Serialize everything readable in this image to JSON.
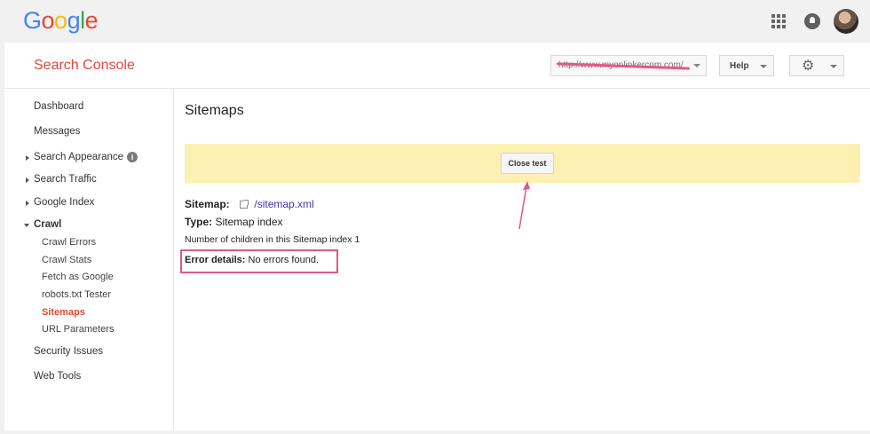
{
  "google_bar": {
    "logo": [
      "G",
      "o",
      "o",
      "g",
      "l",
      "e"
    ],
    "logo_colors": [
      "#4285f4",
      "#ea4335",
      "#fbbc05",
      "#4285f4",
      "#34a853",
      "#ea4335"
    ],
    "apps_icon": "apps-grid-icon",
    "notifications_icon": "bell-icon",
    "account_icon": "avatar"
  },
  "header": {
    "title": "Search Console",
    "site_url": "http://www.myonlinkercom.com/",
    "help_label": "Help",
    "settings_icon": "gear-icon"
  },
  "sidebar": {
    "dashboard": "Dashboard",
    "messages": "Messages",
    "search_appearance": "Search Appearance",
    "search_traffic": "Search Traffic",
    "google_index": "Google Index",
    "crawl": "Crawl",
    "crawl_errors": "Crawl Errors",
    "crawl_stats": "Crawl Stats",
    "fetch_as_google": "Fetch as Google",
    "robots_tester": "robots.txt Tester",
    "sitemaps": "Sitemaps",
    "url_parameters": "URL Parameters",
    "security_issues": "Security Issues",
    "web_tools": "Web Tools"
  },
  "main": {
    "page_title": "Sitemaps",
    "close_test_label": "Close test",
    "sitemap_label": "Sitemap:",
    "sitemap_url": "/sitemap.xml",
    "type_label": "Type:",
    "type_value": "Sitemap index",
    "children_text": "Number of children in this Sitemap index 1",
    "error_label": "Error details:",
    "error_value": "No errors found."
  },
  "colors": {
    "accent": "#dd4b39",
    "annotation": "#e2578b",
    "banner": "#fcf0b3",
    "link": "#4433aa"
  }
}
